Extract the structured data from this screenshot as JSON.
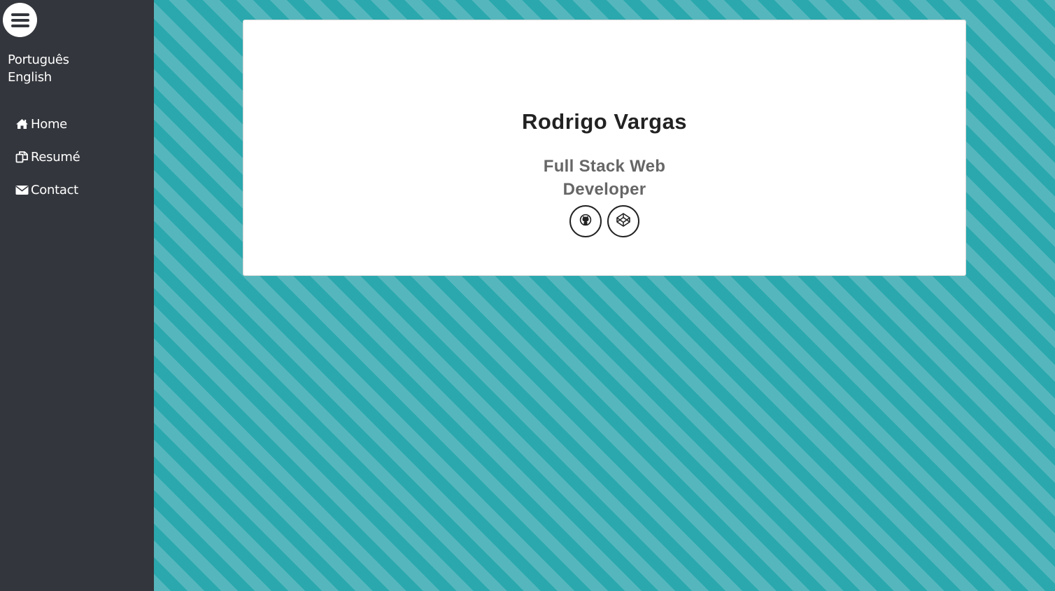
{
  "sidebar": {
    "menu_toggle": "hamburger-menu-icon",
    "languages": [
      "Português",
      "English"
    ],
    "nav": [
      {
        "label": "Home",
        "icon": "home-icon"
      },
      {
        "label": "Resumé",
        "icon": "copy-icon"
      },
      {
        "label": "Contact",
        "icon": "envelope-icon"
      }
    ]
  },
  "profile": {
    "name": "Rodrigo Vargas",
    "title_line1": "Full Stack Web",
    "title_line2": "Developer",
    "socials": [
      {
        "icon": "github-icon"
      },
      {
        "icon": "codepen-icon"
      }
    ]
  },
  "colors": {
    "sidebar_bg": "#33363c",
    "stripe_light": "#55b7bd",
    "stripe_dark": "#2aa8ae",
    "card_bg": "#ffffff"
  }
}
